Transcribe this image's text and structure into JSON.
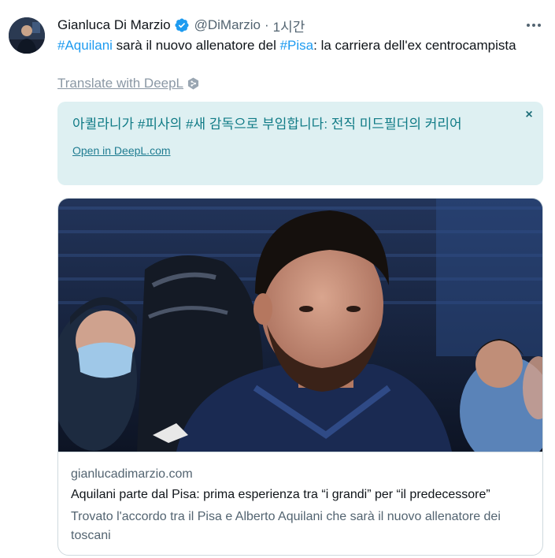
{
  "author": {
    "name": "Gianluca Di Marzio",
    "handle": "@DiMarzio",
    "separator": "·",
    "time": "1시간",
    "verified_icon": "verified-badge-icon",
    "avatar_icon": "avatar-photo"
  },
  "more_icon": "more-dots-icon",
  "tweet": {
    "hashtag1": "#Aquilani",
    "text1": " sarà il nuovo allenatore del ",
    "hashtag2": "#Pisa",
    "text2": ": la carriera dell'ex centrocampista"
  },
  "translate": {
    "link": "Translate with DeepL",
    "icon": "deepl-logo-icon"
  },
  "deepl": {
    "translation": "아퀼라니가 #피사의 #새 감독으로 부임합니다: 전직 미드필더의 커리어",
    "open_link": "Open in DeepL.com",
    "close": "×"
  },
  "card": {
    "image_icon": "card-photo",
    "domain": "gianlucadimarzio.com",
    "title": "Aquilani parte dal Pisa: prima esperienza tra “i grandi” per “il predecessore”",
    "description": "Trovato l'accordo tra il Pisa e Alberto Aquilani che sarà il nuovo allenatore dei toscani"
  },
  "colors": {
    "hashtag": "#1d9bf0",
    "deepl_bg": "#def0f2",
    "deepl_text": "#107b86",
    "verified": "#1d9bf0"
  }
}
